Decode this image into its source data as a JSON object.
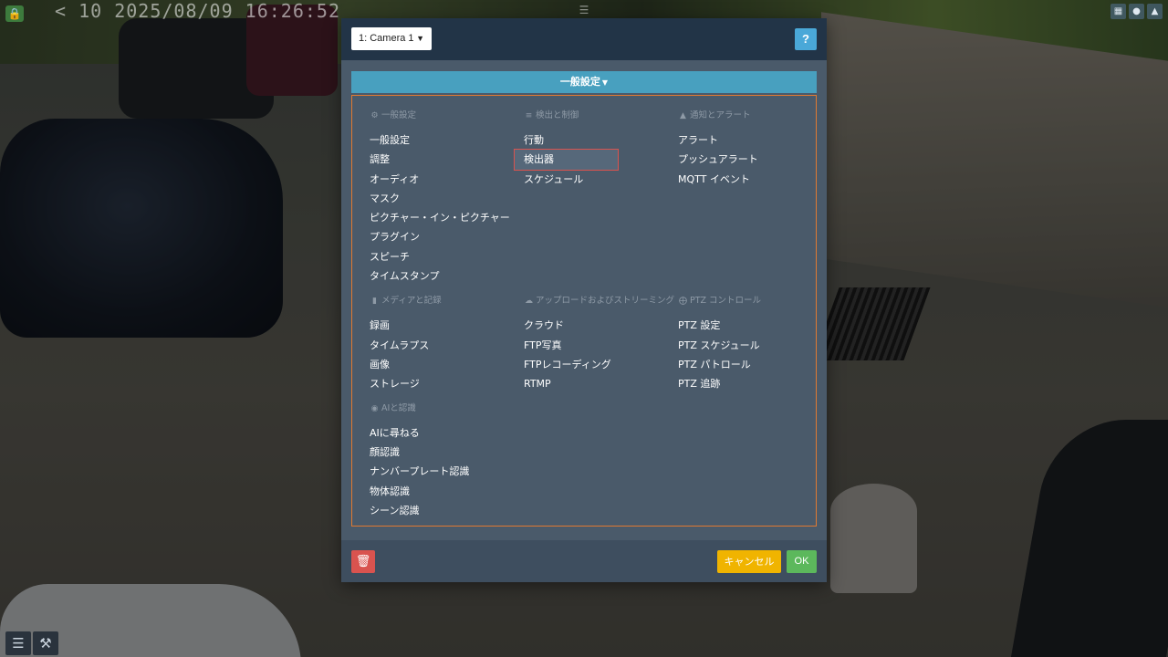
{
  "overlay": {
    "timestamp": "< 10 2025/08/09 16:26:52",
    "lock_icon": "lock-icon",
    "right_icons": [
      "grid-icon",
      "user-icon",
      "bell-icon"
    ],
    "bottom_left_icons": [
      "sliders-icon",
      "wrench-icon"
    ]
  },
  "dialog": {
    "camera_select": "1: Camera 1",
    "help_label": "?",
    "section_label": "一般設定",
    "groups": [
      {
        "title": "一般設定",
        "icon": "gears-icon",
        "items": [
          "一般設定",
          "調整",
          "オーディオ",
          "マスク",
          "ピクチャー・イン・ピクチャー",
          "プラグイン",
          "スピーチ",
          "タイムスタンプ"
        ]
      },
      {
        "title": "検出と制御",
        "icon": "list-check-icon",
        "items": [
          "行動",
          "検出器",
          "スケジュール"
        ]
      },
      {
        "title": "通知とアラート",
        "icon": "warning-icon",
        "items": [
          "アラート",
          "プッシュアラート",
          "MQTT イベント"
        ]
      },
      {
        "title": "メディアと記録",
        "icon": "file-icon",
        "items": [
          "録画",
          "タイムラプス",
          "画像",
          "ストレージ"
        ]
      },
      {
        "title": "アップロードおよびストリーミング",
        "icon": "cloud-upload-icon",
        "items": [
          "クラウド",
          "FTP写真",
          "FTPレコーディング",
          "RTMP"
        ]
      },
      {
        "title": "PTZ コントロール",
        "icon": "ptz-icon",
        "items": [
          "PTZ 設定",
          "PTZ スケジュール",
          "PTZ パトロール",
          "PTZ 追跡"
        ]
      },
      {
        "title": "AIと認識",
        "icon": "eye-icon",
        "items": [
          "AIに尋ねる",
          "顔認識",
          "ナンバープレート認識",
          "物体認識",
          "シーン認識"
        ]
      }
    ],
    "selected_item": "検出器",
    "footer": {
      "cancel_label": "キャンセル",
      "ok_label": "OK",
      "delete_icon": "trash-icon"
    },
    "colors": {
      "header_bg": "#223447",
      "section_bar": "#48a0bf",
      "panel_border": "#e07a32",
      "selected_border": "#d9534f",
      "cancel": "#f0b400",
      "ok": "#5cb85c",
      "delete": "#d9534f"
    }
  }
}
